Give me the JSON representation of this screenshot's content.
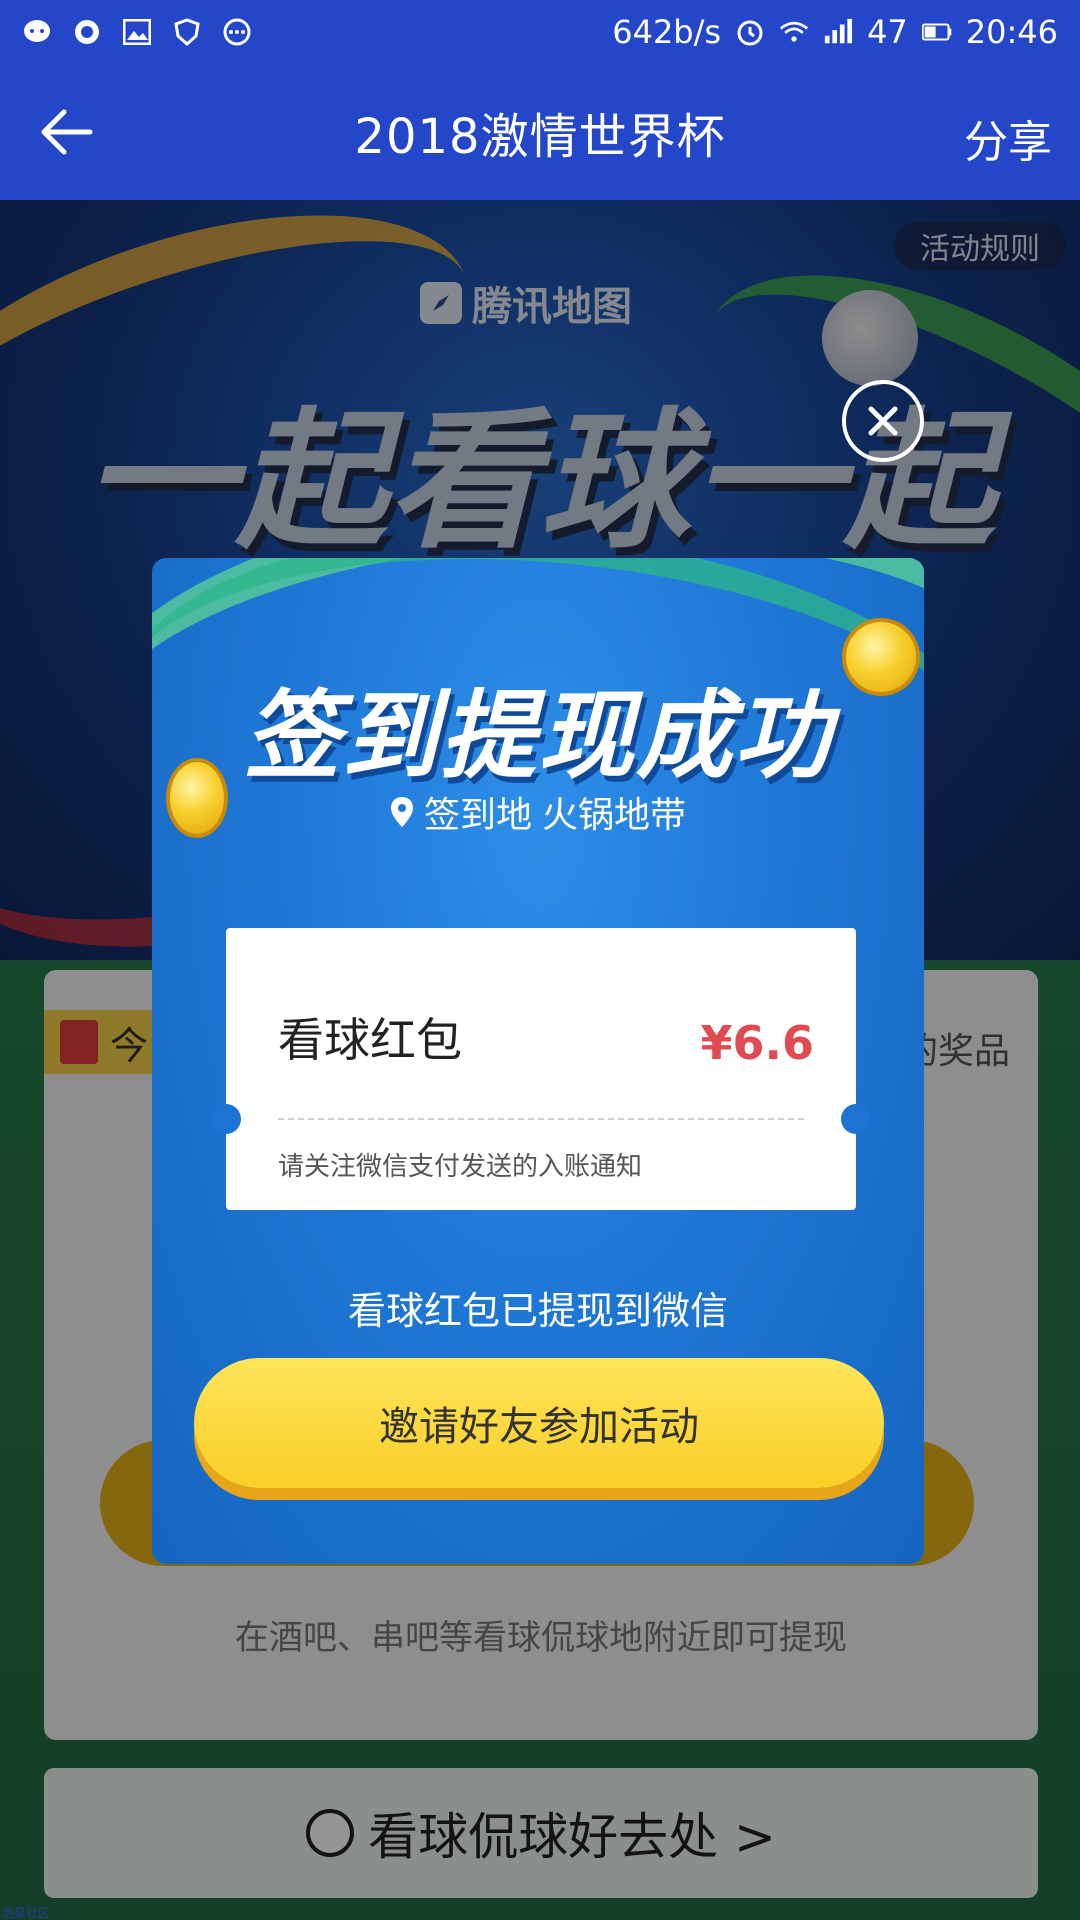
{
  "status_bar": {
    "network_speed": "642b/s",
    "battery": "47",
    "time": "20:46",
    "icons": [
      "chat-icon",
      "qq-icon",
      "gallery-icon",
      "shield-icon",
      "more-icon",
      "alarm-icon",
      "wifi-icon",
      "signal-icon",
      "battery-icon"
    ]
  },
  "app_bar": {
    "title": "2018激情世界杯",
    "share_label": "分享"
  },
  "banner": {
    "rules_label": "活动规则",
    "brand_name": "腾讯地图",
    "slogan": "一起看球一起嗨"
  },
  "background_card": {
    "tag_text": "今",
    "right_text": "的奖品",
    "note": "在酒吧、串吧等看球侃球地附近即可提现"
  },
  "bottom_link": {
    "label": "看球侃球好去处 >"
  },
  "watermark": "浩星社区",
  "modal": {
    "heading": "签到提现成功",
    "location_prefix": "签到地",
    "location_name": "火锅地带",
    "ticket": {
      "name": "看球红包",
      "amount": "¥6.6",
      "note": "请关注微信支付发送的入账通知"
    },
    "status_text": "看球红包已提现到微信",
    "cta_label": "邀请好友参加活动"
  },
  "colors": {
    "brand_blue": "#2447c9",
    "amount_red": "#e04a53",
    "cta_yellow": "#fbd531"
  }
}
